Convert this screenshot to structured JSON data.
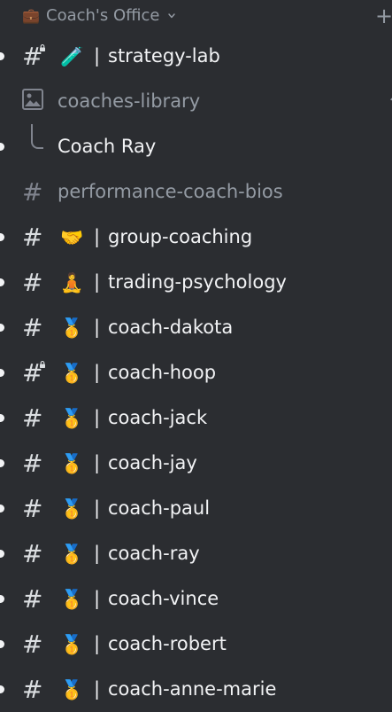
{
  "category": {
    "emoji": "💼",
    "label": "Coach's Office",
    "chevron_icon": "chevron-down-icon",
    "add_icon": "+"
  },
  "channels": [
    {
      "type": "text",
      "locked": true,
      "emoji": "🧪",
      "name": "strategy-lab",
      "unread": true
    },
    {
      "type": "image",
      "locked": false,
      "emoji": "",
      "name": "coaches-library",
      "unread": false,
      "muted": true
    },
    {
      "type": "thread",
      "locked": false,
      "emoji": "",
      "name": "Coach Ray",
      "unread": true
    },
    {
      "type": "text",
      "locked": false,
      "emoji": "",
      "name": "performance-coach-bios",
      "unread": false,
      "muted": true
    },
    {
      "type": "text",
      "locked": false,
      "emoji": "🤝",
      "name": "group-coaching",
      "unread": true
    },
    {
      "type": "text",
      "locked": false,
      "emoji": "🧘",
      "name": "trading-psychology",
      "unread": true
    },
    {
      "type": "text",
      "locked": false,
      "emoji": "🥇",
      "name": "coach-dakota",
      "unread": true
    },
    {
      "type": "text",
      "locked": true,
      "emoji": "🥇",
      "name": "coach-hoop",
      "unread": true
    },
    {
      "type": "text",
      "locked": false,
      "emoji": "🥇",
      "name": "coach-jack",
      "unread": true
    },
    {
      "type": "text",
      "locked": false,
      "emoji": "🥇",
      "name": "coach-jay",
      "unread": true
    },
    {
      "type": "text",
      "locked": false,
      "emoji": "🥇",
      "name": "coach-paul",
      "unread": true
    },
    {
      "type": "text",
      "locked": false,
      "emoji": "🥇",
      "name": "coach-ray",
      "unread": true
    },
    {
      "type": "text",
      "locked": false,
      "emoji": "🥇",
      "name": "coach-vince",
      "unread": true
    },
    {
      "type": "text",
      "locked": false,
      "emoji": "🥇",
      "name": "coach-robert",
      "unread": true
    },
    {
      "type": "text",
      "locked": false,
      "emoji": "🥇",
      "name": "coach-anne-marie",
      "unread": true
    }
  ],
  "separator": "|",
  "hash_symbol": "#",
  "colors": {
    "background": "#2b2d31",
    "text_active": "#f2f3f5",
    "text_muted": "#949ba4",
    "icon_muted": "#80848e"
  }
}
